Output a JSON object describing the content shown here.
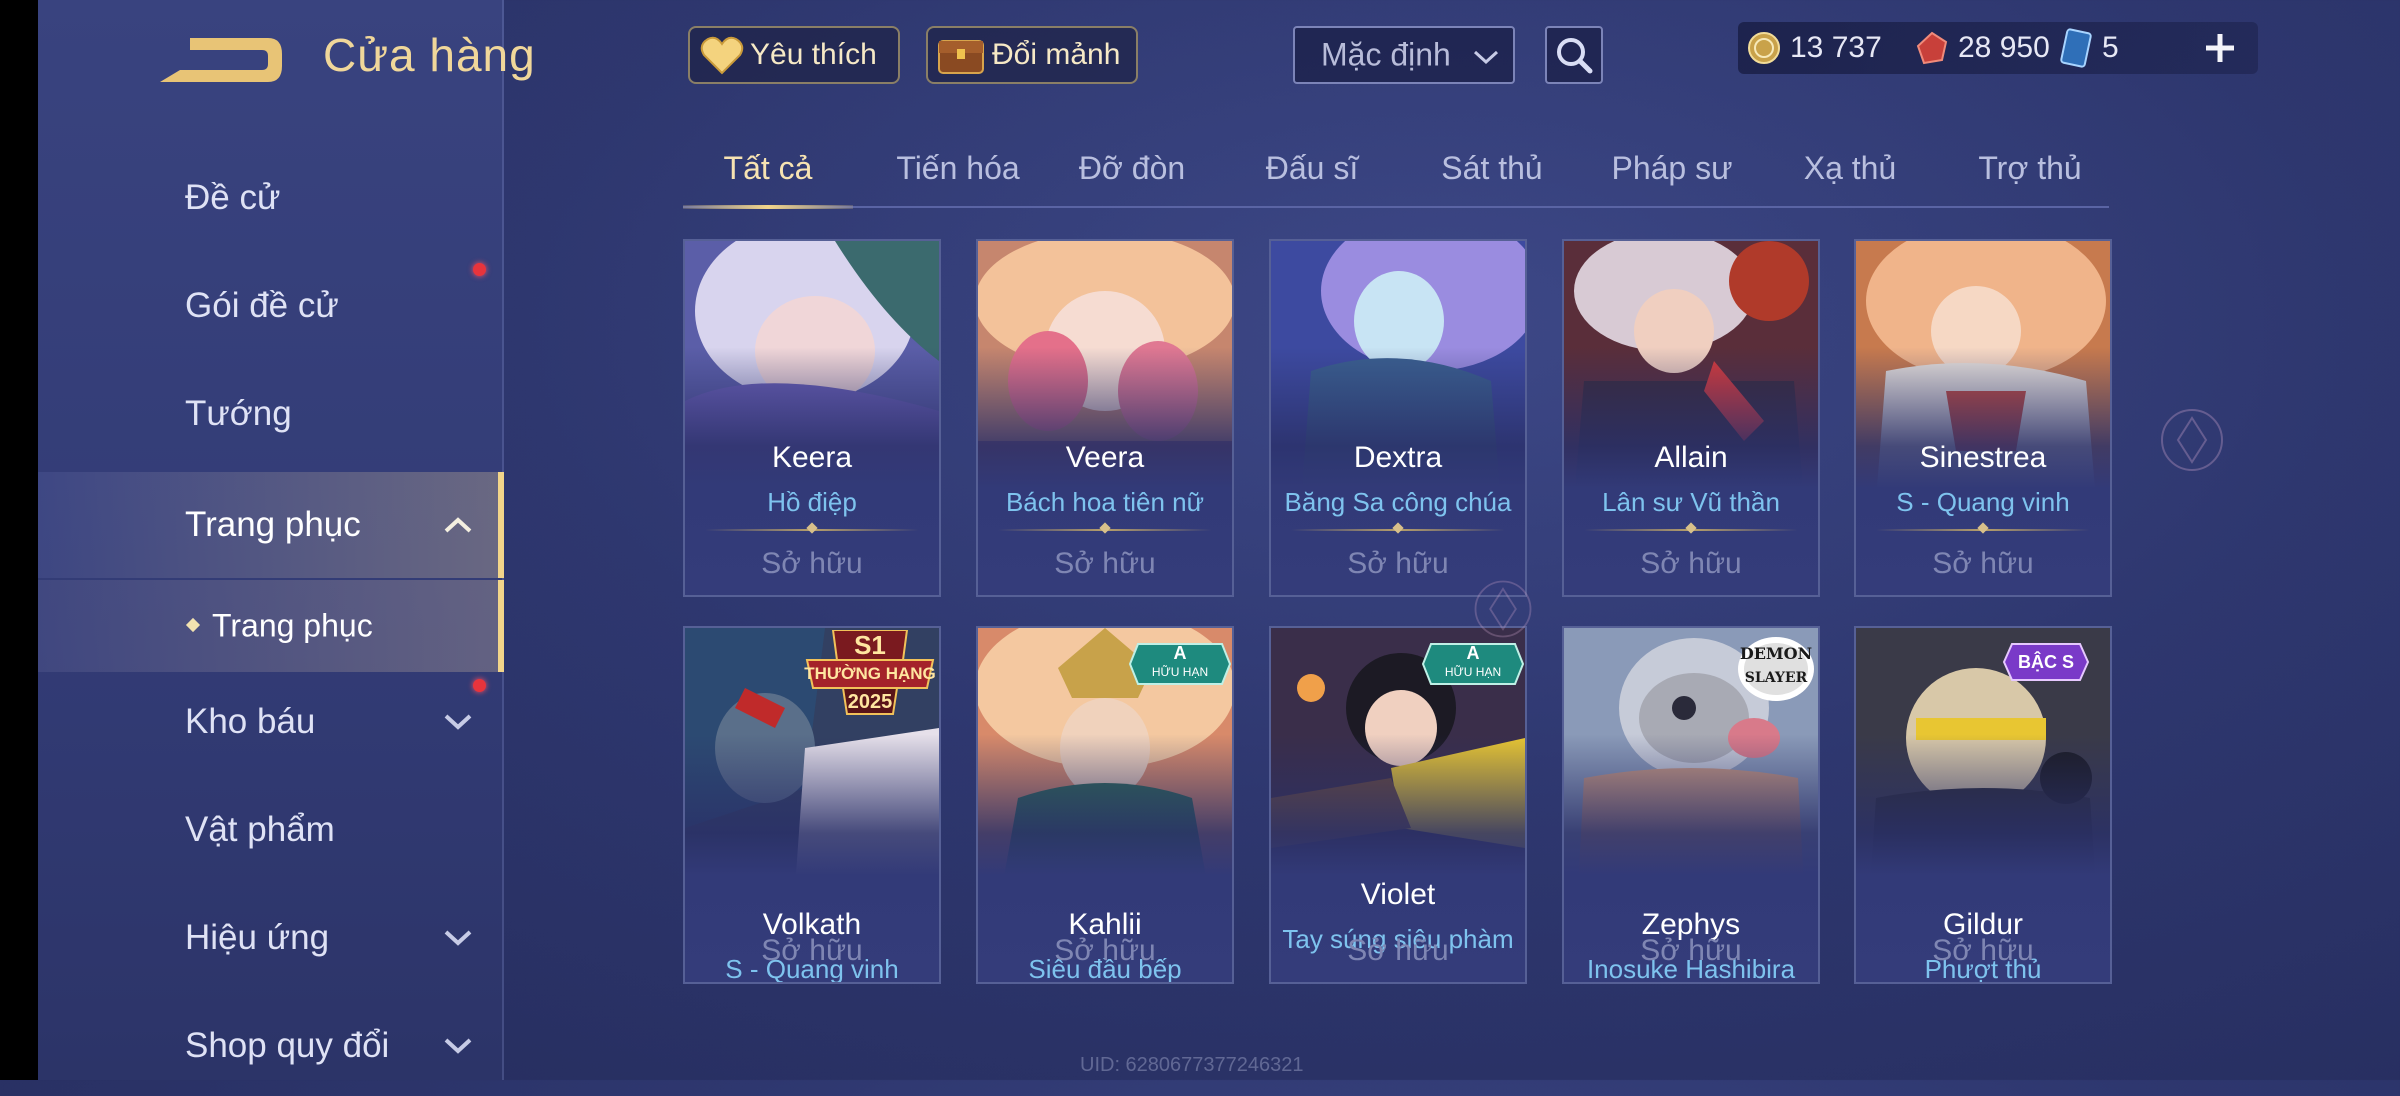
{
  "header": {
    "title": "Cửa hàng",
    "favorites_label": "Yêu thích",
    "exchange_label": "Đổi mảnh",
    "sort_value": "Mặc định"
  },
  "currency": {
    "gold": "13 737",
    "vouchers": "28 950",
    "cards": "5"
  },
  "sidebar": {
    "items": [
      {
        "label": "Đề cử"
      },
      {
        "label": "Gói đề cử"
      },
      {
        "label": "Tướng"
      },
      {
        "label": "Trang phục"
      },
      {
        "label": "Trang phục"
      },
      {
        "label": "Kho báu"
      },
      {
        "label": "Vật phẩm"
      },
      {
        "label": "Hiệu ứng"
      },
      {
        "label": "Shop quy đổi"
      }
    ]
  },
  "tabs": [
    "Tất cả",
    "Tiến hóa",
    "Đỡ đòn",
    "Đấu sĩ",
    "Sát thủ",
    "Pháp sư",
    "Xạ thủ",
    "Trợ thủ"
  ],
  "cards": [
    {
      "name": "Keera",
      "skin": "Hồ điệp",
      "status": "Sở hữu"
    },
    {
      "name": "Veera",
      "skin": "Bách hoa tiên nữ",
      "status": "Sở hữu"
    },
    {
      "name": "Dextra",
      "skin": "Băng Sa công chúa",
      "status": "Sở hữu"
    },
    {
      "name": "Allain",
      "skin": "Lân sư Vũ thần",
      "status": "Sở hữu"
    },
    {
      "name": "Sinestrea",
      "skin": "S - Quang vinh",
      "status": "Sở hữu"
    },
    {
      "name": "Volkath",
      "skin": "S - Quang vinh",
      "status": "Sở hữu",
      "badge_top": "S1",
      "badge_mid": "THƯỜNG HẠNG",
      "badge_bot": "2025"
    },
    {
      "name": "Kahlii",
      "skin": "Siêu đầu bếp",
      "status": "Sở hữu",
      "badge_top": "A",
      "badge_bot": "HỮU HẠN"
    },
    {
      "name": "Violet",
      "skin": "Tay súng siêu phàm",
      "status": "Sở hữu",
      "badge_top": "A",
      "badge_bot": "HỮU HẠN"
    },
    {
      "name": "Zephys",
      "skin": "Inosuke Hashibira",
      "status": "Sở hữu",
      "badge_top": "DEMON",
      "badge_bot": "SLAYER"
    },
    {
      "name": "Gildur",
      "skin": "Phượt thủ",
      "status": "Sở hữu",
      "badge_top": "BẬC S"
    }
  ],
  "uid": "UID: 6280677377246321",
  "colors": {
    "accent_gold": "#f2d58a",
    "skin_blue": "#7ec3ee",
    "owned_gray": "#7f86b3",
    "notification_red": "#e8343c"
  }
}
